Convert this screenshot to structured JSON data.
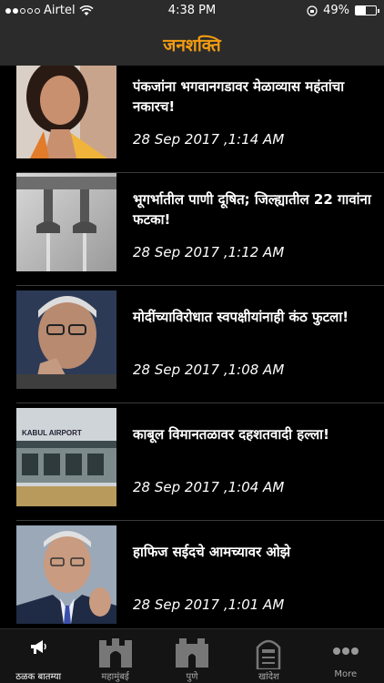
{
  "status_bar": {
    "carrier": "Airtel",
    "time": "4:38 PM",
    "battery_text": "49%",
    "battery_level": 0.49
  },
  "header": {
    "title": "जनशक्ति"
  },
  "news": [
    {
      "headline": "पंकजांना भगवानगडावर मेळाव्यास महंतांचा नकारच!",
      "timestamp": "28 Sep 2017 ,1:14 AM"
    },
    {
      "headline": "भूगर्भातील पाणी दूषित; जिल्ह्यातील 22 गावांना फटका!",
      "timestamp": "28 Sep 2017 ,1:12 AM"
    },
    {
      "headline": "मोदींच्याविरोधात स्वपक्षीयांनाही कंठ फुटला!",
      "timestamp": "28 Sep 2017 ,1:08 AM"
    },
    {
      "headline": "काबूल विमानतळावर दहशतवादी हल्ला!",
      "timestamp": "28 Sep 2017 ,1:04 AM",
      "image_text": "KABUL AIRPORT"
    },
    {
      "headline": "हाफिज सईदचे आमच्यावर ओझे",
      "timestamp": "28 Sep 2017 ,1:01 AM"
    }
  ],
  "tabs": [
    {
      "label": "ठळक बातम्या",
      "icon": "megaphone-icon"
    },
    {
      "label": "महामुंबई",
      "icon": "gateway-icon"
    },
    {
      "label": "पुणे",
      "icon": "shaniwarwada-icon"
    },
    {
      "label": "खांदेश",
      "icon": "monument-icon"
    },
    {
      "label": "More",
      "icon": "more-dots-icon"
    }
  ],
  "colors": {
    "accent": "#f39c12",
    "background": "#000000",
    "header_bg": "#2b2b2b"
  }
}
